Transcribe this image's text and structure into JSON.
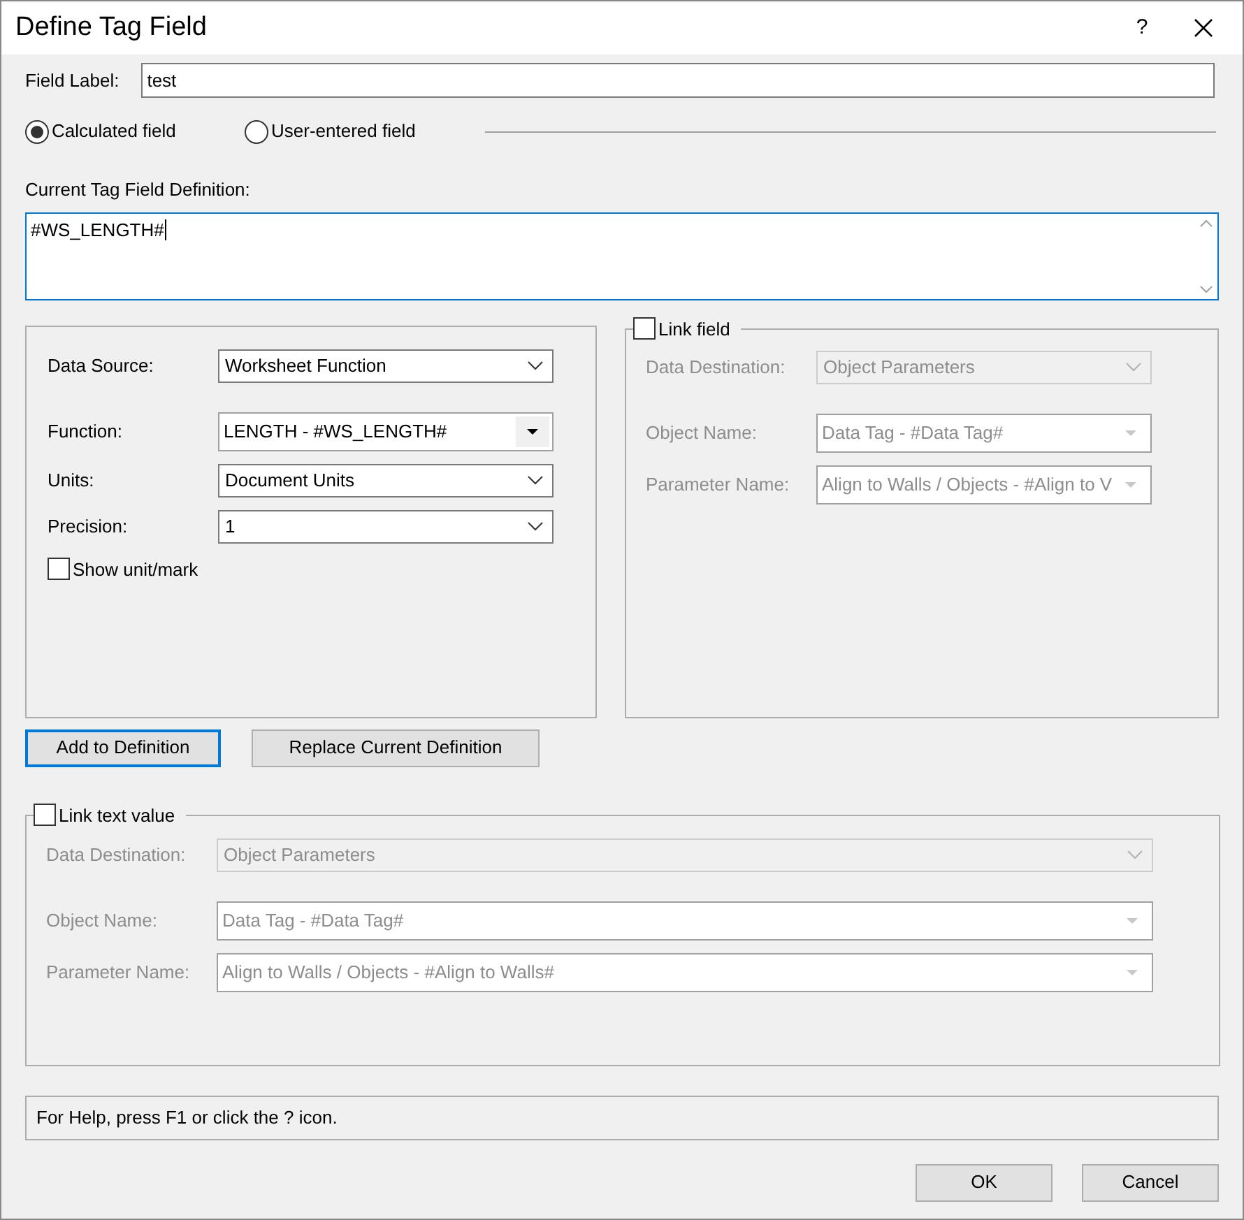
{
  "window": {
    "title": "Define Tag Field",
    "help_button": "?"
  },
  "field_label": {
    "label": "Field Label:",
    "value": "test"
  },
  "field_type": [
    {
      "label": "Calculated field",
      "selected": true
    },
    {
      "label": "User-entered field",
      "selected": false
    }
  ],
  "definition": {
    "label": "Current Tag Field Definition:",
    "value": "#WS_LENGTH#"
  },
  "data_panel": {
    "rows": [
      {
        "kind": "select",
        "label": "Data Source:",
        "value": "Worksheet Function"
      },
      {
        "kind": "combo",
        "label": "Function:",
        "value": "LENGTH - #WS_LENGTH#"
      },
      {
        "kind": "select",
        "label": "Units:",
        "value": "Document Units"
      },
      {
        "kind": "select",
        "label": "Precision:",
        "value": "1"
      }
    ],
    "show_unit": {
      "label": "Show unit/mark",
      "checked": false
    }
  },
  "link_field": {
    "label": "Link field",
    "checked": false,
    "rows": [
      {
        "kind": "select",
        "label": "Data Destination:",
        "value": "Object Parameters"
      },
      {
        "kind": "combo",
        "label": "Object Name:",
        "value": "Data Tag - #Data Tag#"
      },
      {
        "kind": "combo",
        "label": "Parameter Name:",
        "value": "Align to Walls / Objects - #Align to V"
      }
    ]
  },
  "definition_buttons": [
    {
      "label": "Add to Definition",
      "focused": true
    },
    {
      "label": "Replace Current Definition",
      "focused": false
    }
  ],
  "link_text_value": {
    "label": "Link text value",
    "checked": false,
    "rows": [
      {
        "kind": "select",
        "label": "Data Destination:",
        "value": "Object Parameters"
      },
      {
        "kind": "combo",
        "label": "Object Name:",
        "value": "Data Tag - #Data Tag#"
      },
      {
        "kind": "combo",
        "label": "Parameter Name:",
        "value": "Align to Walls / Objects - #Align to Walls#"
      }
    ]
  },
  "help_text": "For Help, press F1 or click the ? icon.",
  "buttons": [
    "OK",
    "Cancel"
  ]
}
